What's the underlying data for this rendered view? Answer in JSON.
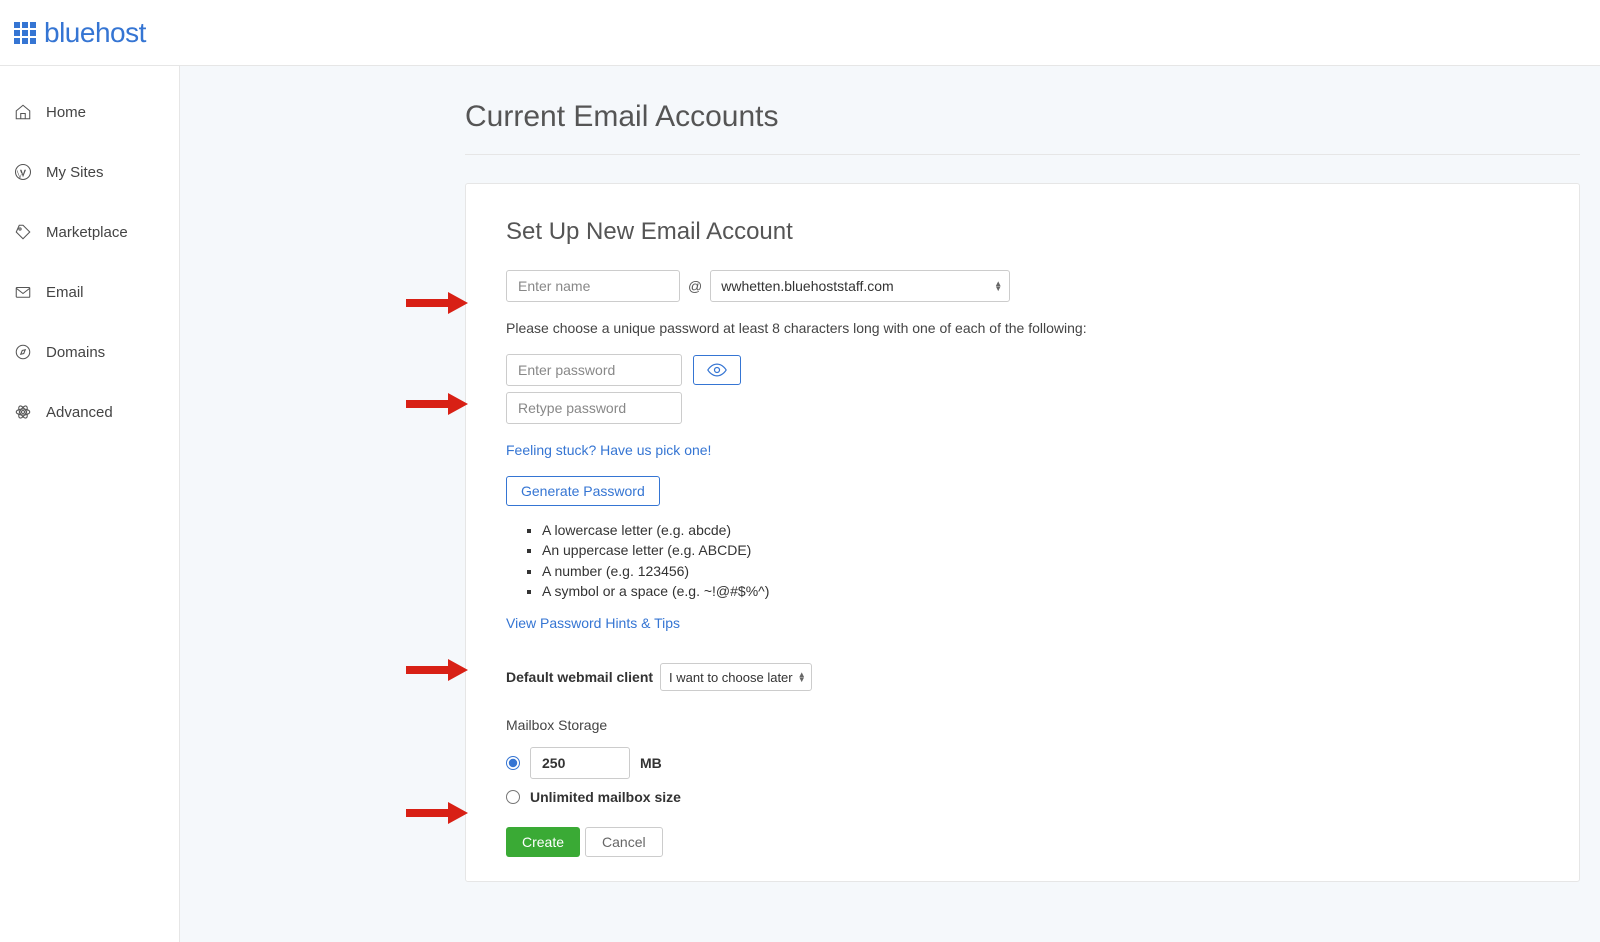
{
  "brand": "bluehost",
  "sidebar": {
    "items": [
      {
        "label": "Home"
      },
      {
        "label": "My Sites"
      },
      {
        "label": "Marketplace"
      },
      {
        "label": "Email"
      },
      {
        "label": "Domains"
      },
      {
        "label": "Advanced"
      }
    ]
  },
  "page": {
    "title": "Current Email Accounts"
  },
  "form": {
    "title": "Set Up New Email Account",
    "name_placeholder": "Enter name",
    "at": "@",
    "domain": "wwhetten.bluehoststaff.com",
    "password_instruction": "Please choose a unique password at least 8 characters long with one of each of the following:",
    "password_placeholder": "Enter password",
    "retype_placeholder": "Retype password",
    "stuck_link": "Feeling stuck? Have us pick one!",
    "generate_btn": "Generate Password",
    "rules": [
      "A lowercase letter (e.g. abcde)",
      "An uppercase letter (e.g. ABCDE)",
      "A number (e.g. 123456)",
      "A symbol or a space (e.g. ~!@#$%^)"
    ],
    "hints_link": "View Password Hints & Tips",
    "webmail_label": "Default webmail client",
    "webmail_value": "I want to choose later",
    "storage_title": "Mailbox Storage",
    "storage_value": "250",
    "storage_unit": "MB",
    "unlimited_label": "Unlimited mailbox size",
    "create_btn": "Create",
    "cancel_btn": "Cancel"
  }
}
